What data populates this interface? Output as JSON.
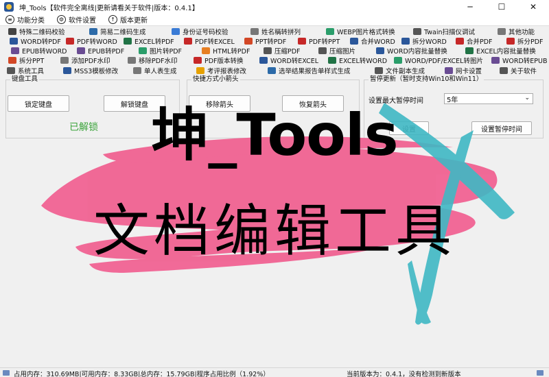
{
  "window": {
    "title": "坤_Tools【软件完全离线|更新请看关于软件|版本：0.4.1】",
    "minimize": "─",
    "maximize": "☐",
    "close": "✕"
  },
  "menu": [
    {
      "label": "功能分类",
      "icon": "≡"
    },
    {
      "label": "软件设置",
      "icon": "⚙"
    },
    {
      "label": "版本更新",
      "icon": "↑"
    }
  ],
  "toolbar_rows": [
    [
      {
        "label": "特殊二维码校验",
        "icon": "qr-icon",
        "color": "#444"
      },
      {
        "label": "简易二维码生成",
        "icon": "qr-icon",
        "color": "#2c6aa8"
      },
      {
        "label": "身份证号码校验",
        "icon": "id-card-icon",
        "color": "#3a7bd5"
      },
      {
        "label": "姓名稱转拼列",
        "icon": "table-icon",
        "color": "#777"
      },
      {
        "label": "WEBP图片格式转换",
        "icon": "image-icon",
        "color": "#2a9d6a"
      },
      {
        "label": "Twain扫描仪调试",
        "icon": "scanner-icon",
        "color": "#555"
      },
      {
        "label": "其他功能",
        "icon": "more-icon",
        "color": "#777"
      }
    ],
    [
      {
        "label": "WORD转PDF",
        "icon": "word-icon",
        "color": "#2b579a"
      },
      {
        "label": "PDF转WORD",
        "icon": "pdf-icon",
        "color": "#c62828"
      },
      {
        "label": "EXCEL转PDF",
        "icon": "excel-icon",
        "color": "#217346"
      },
      {
        "label": "PDF转EXCEL",
        "icon": "pdf-icon",
        "color": "#c62828"
      },
      {
        "label": "PPT转PDF",
        "icon": "ppt-icon",
        "color": "#d24726"
      },
      {
        "label": "PDF转PPT",
        "icon": "pdf-icon",
        "color": "#c62828"
      },
      {
        "label": "合并WORD",
        "icon": "merge-icon",
        "color": "#2b579a"
      },
      {
        "label": "拆分WORD",
        "icon": "split-icon",
        "color": "#2b579a"
      },
      {
        "label": "合并PDF",
        "icon": "merge-icon",
        "color": "#c62828"
      },
      {
        "label": "拆分PDF",
        "icon": "split-icon",
        "color": "#c62828"
      }
    ],
    [
      {
        "label": "EPUB转WORD",
        "icon": "epub-icon",
        "color": "#6a4c93"
      },
      {
        "label": "EPUB转PDF",
        "icon": "epub-icon",
        "color": "#6a4c93"
      },
      {
        "label": "图片转PDF",
        "icon": "image-icon",
        "color": "#2a9d6a"
      },
      {
        "label": "HTML转PDF",
        "icon": "html-icon",
        "color": "#e67e22"
      },
      {
        "label": "压缩PDF",
        "icon": "compress-icon",
        "color": "#555"
      },
      {
        "label": "压缩图片",
        "icon": "compress-icon",
        "color": "#555"
      },
      {
        "label": "WORD内容批量替换",
        "icon": "word-icon",
        "color": "#2b579a"
      },
      {
        "label": "EXCEL内容批量替换",
        "icon": "excel-icon",
        "color": "#217346"
      }
    ],
    [
      {
        "label": "拆分PPT",
        "icon": "ppt-icon",
        "color": "#d24726"
      },
      {
        "label": "添加PDF水印",
        "icon": "watermark-icon",
        "color": "#777"
      },
      {
        "label": "移除PDF水印",
        "icon": "watermark-icon",
        "color": "#777"
      },
      {
        "label": "PDF版本转换",
        "icon": "pdf-icon",
        "color": "#c62828"
      },
      {
        "label": "WORD转EXCEL",
        "icon": "word-icon",
        "color": "#2b579a"
      },
      {
        "label": "EXCEL转WORD",
        "icon": "excel-icon",
        "color": "#217346"
      },
      {
        "label": "WORD/PDF/EXCEL转图片",
        "icon": "image-icon",
        "color": "#2a9d6a"
      },
      {
        "label": "WORD转EPUB",
        "icon": "epub-icon",
        "color": "#6a4c93"
      }
    ],
    [
      {
        "label": "系统工具",
        "icon": "gear-icon",
        "color": "#555"
      },
      {
        "label": "MSS3模板修改",
        "icon": "template-icon",
        "color": "#2b579a"
      },
      {
        "label": "单人表生成",
        "icon": "form-icon",
        "color": "#777"
      },
      {
        "label": "考评报表修改",
        "icon": "report-icon",
        "color": "#e6a100"
      },
      {
        "label": "选举结果报告单样式生成",
        "icon": "report-icon",
        "color": "#2c6aa8"
      },
      {
        "label": "文件副本生成",
        "icon": "file-icon",
        "color": "#555"
      },
      {
        "label": "网卡设置",
        "icon": "network-icon",
        "color": "#6a4c93"
      },
      {
        "label": "关于软件",
        "icon": "info-icon",
        "color": "#555"
      }
    ]
  ],
  "keyboard_panel": {
    "title": "键盘工具",
    "lock_button": "锁定键盘",
    "unlock_button": "解锁键盘",
    "status": "已解锁"
  },
  "shortcut_panel": {
    "title": "快捷方式小箭头",
    "remove_button": "移除箭头",
    "restore_button": "恢复箭头"
  },
  "pause_panel": {
    "title": "暂停更新（暂时支持Win10和Win11）",
    "max_pause_label": "设置最大暂停时间",
    "max_pause_value": "5年",
    "reset_button": "设置",
    "set_pause_button": "设置暂停时间"
  },
  "overlay": {
    "title": "坤_Tools",
    "subtitle": "文档编辑工具",
    "pink": "#f06292",
    "teal": "#3fb8c4"
  },
  "statusbar": {
    "memory": "占用内存：310.69MB|可用内存：8.33GB|总内存：15.79GB|程序占用比例（1.92%）",
    "version": "当前版本为：0.4.1，没有检测到新版本"
  }
}
